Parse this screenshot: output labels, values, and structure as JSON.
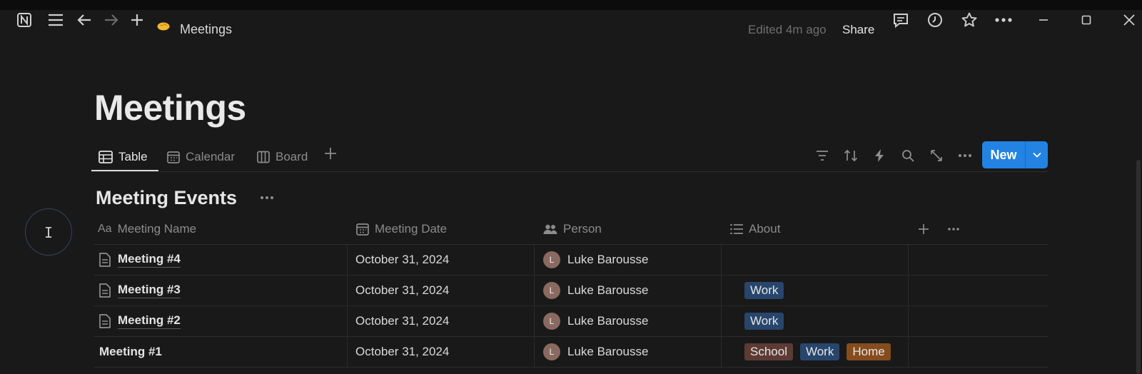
{
  "titlebar": {
    "breadcrumb": "Meetings",
    "edited": "Edited 4m ago",
    "share": "Share"
  },
  "page": {
    "title": "Meetings"
  },
  "tabs": [
    {
      "label": "Table",
      "icon": "table-icon",
      "active": true
    },
    {
      "label": "Calendar",
      "icon": "calendar-icon",
      "active": false
    },
    {
      "label": "Board",
      "icon": "board-icon",
      "active": false
    }
  ],
  "toolbar": {
    "new_label": "New"
  },
  "database": {
    "title": "Meeting Events",
    "columns": [
      {
        "label": "Meeting Name",
        "prefix": "Aa"
      },
      {
        "label": "Meeting Date",
        "icon": "calendar-icon"
      },
      {
        "label": "Person",
        "icon": "people-icon"
      },
      {
        "label": "About",
        "icon": "list-icon"
      }
    ],
    "rows": [
      {
        "name": "Meeting #4",
        "date": "October 31, 2024",
        "person": "Luke Barousse",
        "initial": "L",
        "tags": []
      },
      {
        "name": "Meeting #3",
        "date": "October 31, 2024",
        "person": "Luke Barousse",
        "initial": "L",
        "tags": [
          "Work"
        ]
      },
      {
        "name": "Meeting #2",
        "date": "October 31, 2024",
        "person": "Luke Barousse",
        "initial": "L",
        "tags": [
          "Work"
        ]
      },
      {
        "name": "Meeting #1",
        "date": "October 31, 2024",
        "person": "Luke Barousse",
        "initial": "L",
        "tags": [
          "School",
          "Work",
          "Home"
        ]
      }
    ]
  },
  "colors": {
    "accent": "#2383e2",
    "tag_work": "#28456c",
    "tag_school": "#5c3b34",
    "tag_home": "#854c1d"
  }
}
